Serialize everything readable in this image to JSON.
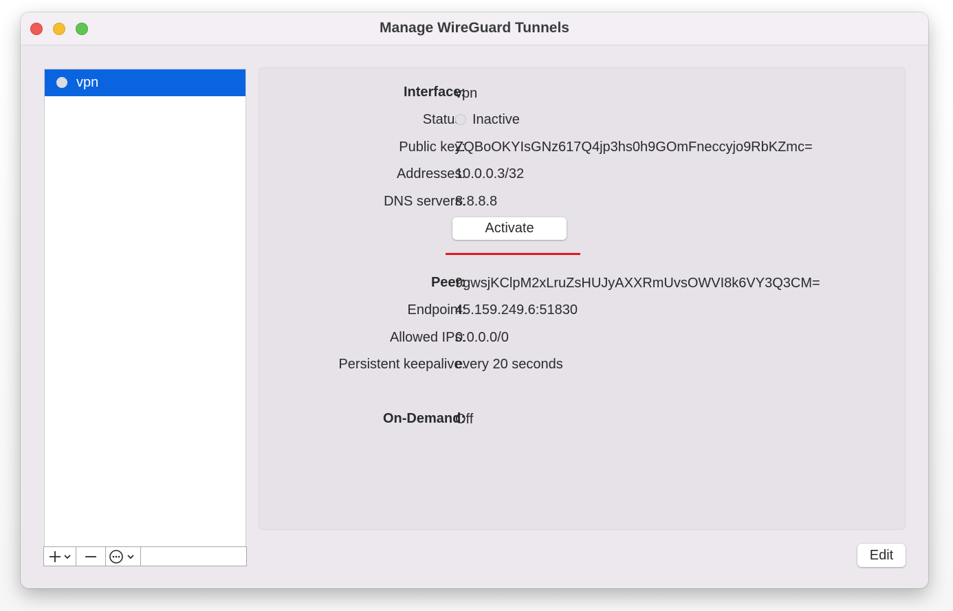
{
  "window": {
    "title": "Manage WireGuard Tunnels"
  },
  "sidebar": {
    "tunnels": [
      {
        "name": "vpn",
        "selected": true
      }
    ],
    "toolbar": {
      "add_icon": "plus-icon",
      "remove_icon": "minus-icon",
      "action_icon": "ellipsis-circle-icon"
    }
  },
  "interface": {
    "interface_label": "Interface:",
    "interface_value": "vpn",
    "status_label": "Status:",
    "status_value": "Inactive",
    "public_key_label": "Public key:",
    "public_key_value": "ZQBoOKYIsGNz617Q4jp3hs0h9GOmFneccyjo9RbKZmc=",
    "addresses_label": "Addresses:",
    "addresses_value": "10.0.0.3/32",
    "dns_label": "DNS servers:",
    "dns_value": "8.8.8.8",
    "activate_label": "Activate"
  },
  "peer": {
    "peer_label": "Peer:",
    "peer_value": "9gwsjKClpM2xLruZsHUJyAXXRmUvsOWVI8k6VY3Q3CM=",
    "endpoint_label": "Endpoint:",
    "endpoint_value": "45.159.249.6:51830",
    "allowed_ips_label": "Allowed IPs:",
    "allowed_ips_value": "0.0.0.0/0",
    "keepalive_label": "Persistent keepalive:",
    "keepalive_value": "every 20 seconds"
  },
  "on_demand": {
    "label": "On-Demand:",
    "value": "Off"
  },
  "footer": {
    "edit_label": "Edit"
  },
  "colors": {
    "selection": "#0a64e0",
    "highlight_underline": "#e0191c",
    "close": "#ed5c57",
    "minimize": "#f5be30",
    "maximize": "#61c554"
  }
}
